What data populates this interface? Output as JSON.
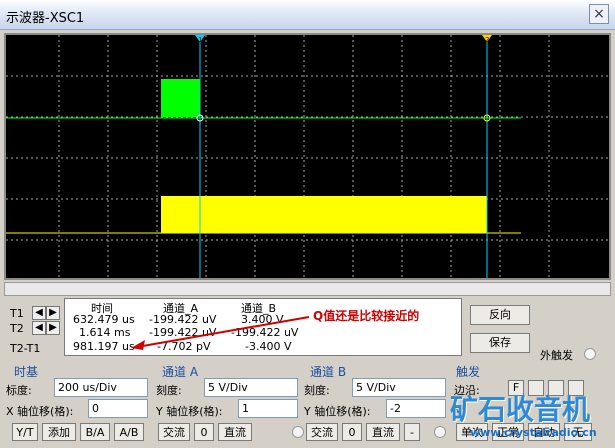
{
  "window": {
    "title": "示波器-XSC1",
    "close_label": "×"
  },
  "screen": {
    "background": "#000000",
    "channel_a_color": "#00ff00",
    "channel_b_color": "#ffff00",
    "cursor_color": "#00d0ff",
    "cursor1_label": "1",
    "cursor2_label": "2"
  },
  "readout": {
    "headers": [
      "时间",
      "通道_A",
      "通道_B"
    ],
    "rows": [
      {
        "label": "T1",
        "time": "632.479 us",
        "a": "-199.422 uV",
        "b": "3.400 V"
      },
      {
        "label": "T2",
        "time": "1.614 ms",
        "a": "-199.422 uV",
        "b": "-199.422 uV"
      },
      {
        "label": "T2-T1",
        "time": "981.197 us",
        "a": "-7.702 pV",
        "b": "-3.400 V"
      }
    ]
  },
  "annotation": {
    "text": "Q值还是比较接近的",
    "color": "#d00000"
  },
  "buttons": {
    "reverse": "反向",
    "save": "保存",
    "ext_trigger": "外触发"
  },
  "timebase": {
    "title": "时基",
    "scale_label": "标度:",
    "scale_value": "200 us/Div",
    "xpos_label": "X 轴位移(格):",
    "xpos_value": "0",
    "modes": [
      "Y/T",
      "添加",
      "B/A",
      "A/B"
    ]
  },
  "channel_a": {
    "title": "通道 A",
    "scale_label": "刻度:",
    "scale_value": "5  V/Div",
    "ypos_label": "Y 轴位移(格):",
    "ypos_value": "1",
    "coupling": [
      "交流",
      "0",
      "直流"
    ]
  },
  "channel_b": {
    "title": "通道 B",
    "scale_label": "刻度:",
    "scale_value": "5  V/Div",
    "ypos_label": "Y 轴位移(格):",
    "ypos_value": "-2",
    "coupling": [
      "交流",
      "0",
      "直流",
      "-"
    ]
  },
  "trigger": {
    "title": "触发",
    "edge_label": "边沿:",
    "level_label": "平",
    "edge_value": "F",
    "mode_buttons": [
      "单次",
      "正常",
      "自动",
      "无"
    ]
  },
  "watermark": {
    "cn": "矿石收音机",
    "url": "www.crystalradio.cn"
  }
}
